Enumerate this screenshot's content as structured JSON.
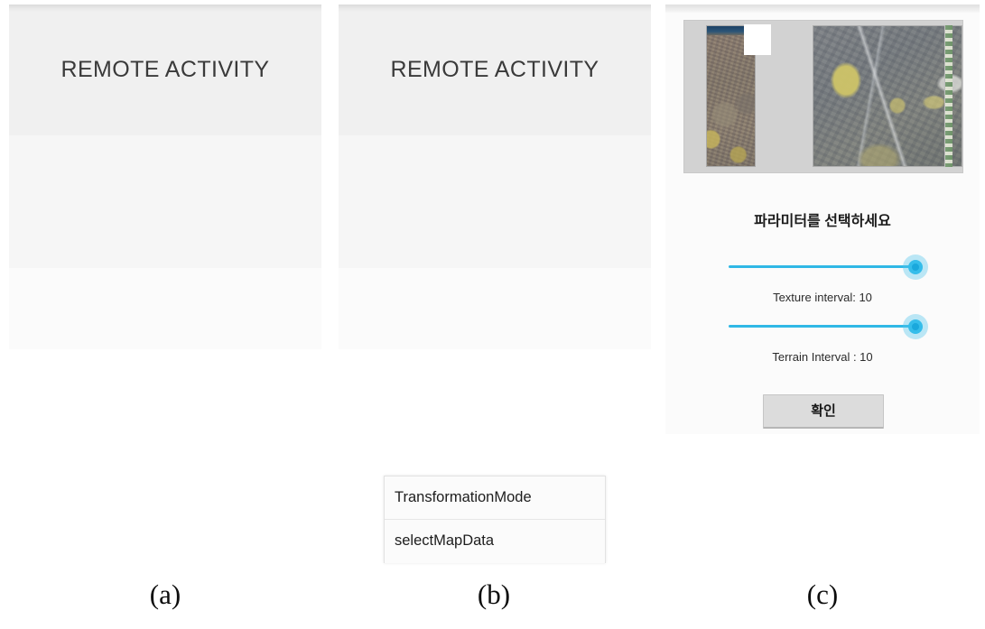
{
  "figure": {
    "captions": [
      {
        "id": "a",
        "label": "(a)"
      },
      {
        "id": "b",
        "label": "(b)"
      },
      {
        "id": "c",
        "label": "(c)"
      }
    ]
  },
  "panel_a": {
    "activity_title": "REMOTE ACTIVITY"
  },
  "panel_b": {
    "activity_title": "REMOTE ACTIVITY",
    "dialog": {
      "items": [
        {
          "label": "TransformationMode"
        },
        {
          "label": "selectMapData"
        }
      ]
    }
  },
  "panel_c": {
    "preview": {
      "left_image_name": "aerial-strip-thumbnail",
      "right_image_name": "aerial-terrain-thumbnail",
      "overlay_name": "white-selection-square",
      "colorbar_name": "green-vertical-strip"
    },
    "heading": "파라미터를 선택하세요",
    "sliders": [
      {
        "name": "texture-interval-slider",
        "label": "Texture interval: 10",
        "value": 10,
        "percent": 100
      },
      {
        "name": "terrain-interval-slider",
        "label": "Terrain Interval : 10",
        "value": 10,
        "percent": 100
      }
    ],
    "confirm_button": "확인"
  },
  "colors": {
    "slider_accent": "#35bdea",
    "slider_track": "#30b8e6",
    "screen_background": "#f6f6f6",
    "screen_header": "#f0f0f0",
    "preview_background": "#d2d2d2",
    "button_face": "#dcdcdc",
    "title_text": "#3a3a3a"
  }
}
